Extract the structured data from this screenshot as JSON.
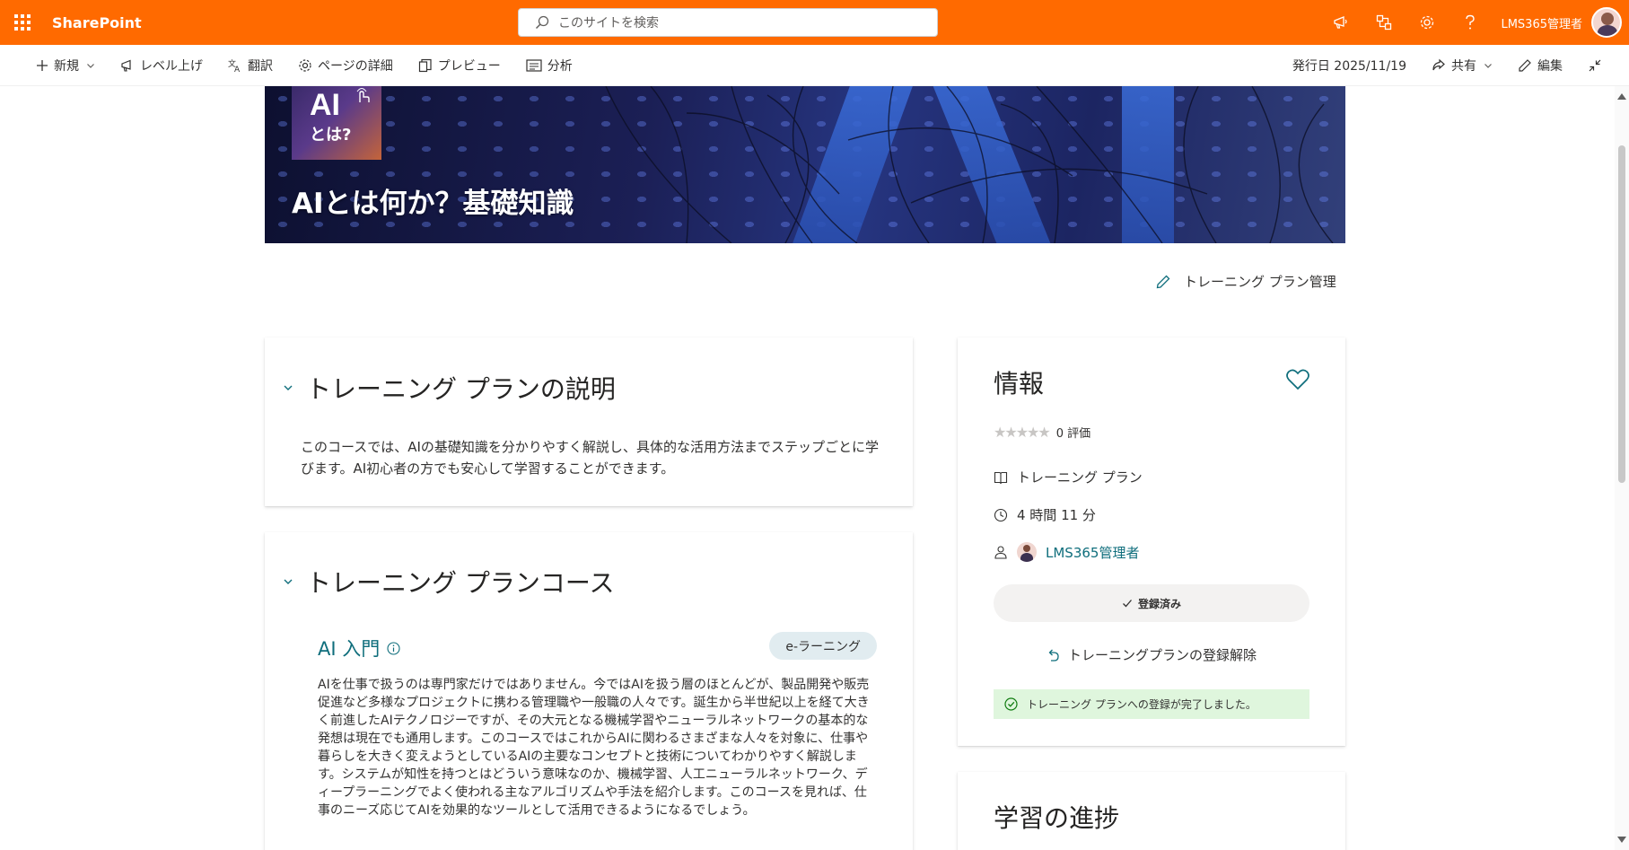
{
  "suite": {
    "brand": "SharePoint",
    "search_placeholder": "このサイトを検索",
    "user_name": "LMS365管理者"
  },
  "commandbar": {
    "new_label": "新規",
    "promote_label": "レベル上げ",
    "translate_label": "翻訳",
    "page_details_label": "ページの詳細",
    "preview_label": "プレビュー",
    "analytics_label": "分析",
    "published_label": "発行日 2025/11/19",
    "share_label": "共有",
    "edit_label": "編集"
  },
  "hero": {
    "thumb_line1": "AI",
    "thumb_line2": "とは?",
    "title": "AIとは何か？基礎知識"
  },
  "manage_label": "トレーニング プラン管理",
  "description_section": {
    "title": "トレーニング プランの説明",
    "text": "このコースでは、AIの基礎知識を分かりやすく解説し、具体的な活用方法までステップごとに学びます。AI初心者の方でも安心して学習することができます。"
  },
  "courses_section": {
    "title": "トレーニング プランコース",
    "course": {
      "title": "AI 入門",
      "type": "e-ラーニング",
      "description": "AIを仕事で扱うのは専門家だけではありません。今ではAIを扱う層のほとんどが、製品開発や販売促進など多様なプロジェクトに携わる管理職や一般職の人々です。誕生から半世紀以上を経て大きく前進したAIテクノロジーですが、その大元となる機械学習やニューラルネットワークの基本的な発想は現在でも通用します。このコースではこれからAIに関わるさまざまな人々を対象に、仕事や暮らしを大きく変えようとしているAIの主要なコンセプトと技術についてわかりやすく解説します。システムが知性を持つとはどういう意味なのか、機械学習、人工ニューラルネットワーク、ディープラーニングでよく使われる主なアルゴリズムや手法を紹介します。このコースを見れば、仕事のニーズ応じてAIを効果的なツールとして活用できるようになるでしょう。"
    }
  },
  "info": {
    "title": "情報",
    "rating": 0,
    "rating_count": "0 評価",
    "type": "トレーニング プラン",
    "duration": "4 時間 11 分",
    "owner": "LMS365管理者",
    "enrolled_label": "登録済み",
    "unenroll_label": "トレーニングプランの登録解除",
    "success_message": "トレーニング プランへの登録が完了しました。"
  },
  "progress": {
    "title": "学習の進捗"
  },
  "colors": {
    "suite_bar": "#ff6a00",
    "accent": "#0f6e7c",
    "success_bg": "#dff6dd"
  }
}
